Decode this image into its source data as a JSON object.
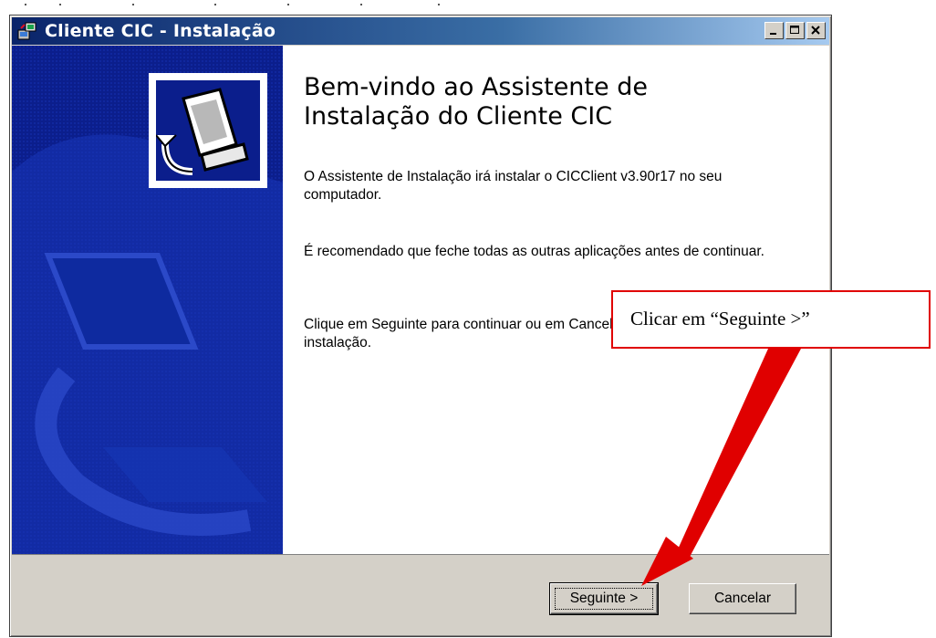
{
  "window": {
    "title": "Cliente CIC - Instalação",
    "controls": {
      "minimize": "_",
      "maximize": "□",
      "close": "✕"
    }
  },
  "wizard": {
    "heading": "Bem-vindo ao Assistente de Instalação do Cliente CIC",
    "paragraph1": "O Assistente de Instalação irá instalar o CICClient v3.90r17 no seu computador.",
    "paragraph2": "É recomendado que feche todas as outras aplicações antes de continuar.",
    "paragraph3": "Clique em Seguinte para continuar ou em Cancelar para cancelar a instalação."
  },
  "buttons": {
    "next": "Seguinte >",
    "cancel": "Cancelar"
  },
  "annotation": {
    "callout": "Clicar em “Seguinte >”",
    "color": "#e00000"
  },
  "colors": {
    "side_panel": "#0b1e8c",
    "title_bar": "#0a246a",
    "dialog_face": "#d4d0c8"
  },
  "icons": {
    "title": "installer-icon",
    "logo": "computer-install-icon"
  }
}
